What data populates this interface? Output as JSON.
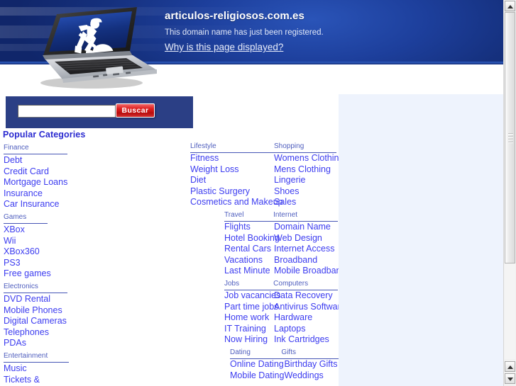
{
  "banner": {
    "domain": "articulos-religiosos.com.es",
    "subtitle": "This domain name has just been registered.",
    "why_link": "Why is this page displayed?",
    "image_alt": "laptop-under-construction"
  },
  "search": {
    "value": "",
    "placeholder": "",
    "button_label": "Buscar"
  },
  "headings": {
    "popular_categories": "Popular Categories"
  },
  "left_categories": [
    {
      "title": "Finance",
      "links": [
        "Debt",
        "Credit Card",
        "Mortgage Loans",
        "Insurance",
        "Car Insurance"
      ]
    },
    {
      "title": "Games",
      "links": [
        "XBox",
        "Wii",
        "XBox360",
        "PS3",
        "Free games"
      ]
    },
    {
      "title": "Electronics",
      "links": [
        "DVD Rental",
        "Mobile Phones",
        "Digital Cameras",
        "Telephones",
        "PDAs"
      ]
    },
    {
      "title": "Entertainment",
      "links": [
        "Music",
        "Tickets &"
      ]
    }
  ],
  "grid_categories": [
    {
      "left": {
        "title": "Lifestyle",
        "links": [
          "Fitness",
          "Weight Loss",
          "Diet",
          "Plastic Surgery",
          "Cosmetics and Makeup"
        ]
      },
      "right": {
        "title": "Shopping",
        "links": [
          "Womens Clothing",
          "Mens Clothing",
          "Lingerie",
          "Shoes",
          "Sales"
        ]
      }
    },
    {
      "left": {
        "title": "Travel",
        "links": [
          "Flights",
          "Hotel Booking",
          "Rental Cars",
          "Vacations",
          "Last Minute"
        ]
      },
      "right": {
        "title": "Internet",
        "links": [
          "Domain Name",
          "Web Design",
          "Internet Access",
          "Broadband",
          "Mobile Broadband"
        ]
      }
    },
    {
      "left": {
        "title": "Jobs",
        "links": [
          "Job vacancies",
          "Part time jobs",
          "Home work",
          "IT Training",
          "Now Hiring"
        ]
      },
      "right": {
        "title": "Computers",
        "links": [
          "Data Recovery",
          "Antivirus Software",
          "Hardware",
          "Laptops",
          "Ink Cartridges"
        ]
      }
    },
    {
      "left": {
        "title": "Dating",
        "links": [
          "Online Dating",
          "Mobile Dating"
        ]
      },
      "right": {
        "title": "Gifts",
        "links": [
          "Birthday Gifts",
          "Weddings"
        ]
      }
    }
  ],
  "colors": {
    "banner_blue": "#1d3f9c",
    "search_panel": "#2b3f85",
    "link_blue": "#3c3cf0",
    "heading_blue": "#2a2ad0",
    "button_red": "#d01f1f",
    "right_panel": "#eef3fd"
  }
}
